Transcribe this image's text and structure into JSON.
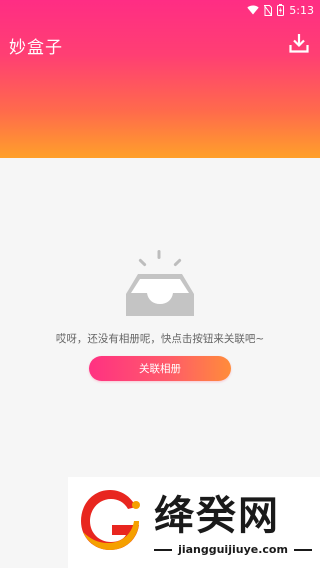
{
  "status_bar": {
    "time": "5:13",
    "icons": [
      "wifi-icon",
      "no-sim-icon",
      "battery-charging-icon"
    ]
  },
  "header": {
    "title": "妙盒子",
    "download_icon": "download-icon",
    "gradient": [
      "#ff2d84",
      "#ffa02a"
    ]
  },
  "empty_state": {
    "icon": "empty-inbox-icon",
    "message": "哎呀，还没有相册呢，快点击按钮来关联吧~",
    "button_label": "关联相册"
  },
  "watermark": {
    "brand": "绛癸网",
    "url": "jiangguijiuye.com"
  },
  "colors": {
    "accent": "#ff3182",
    "background": "#f6f6f6",
    "text_muted": "#666666"
  }
}
